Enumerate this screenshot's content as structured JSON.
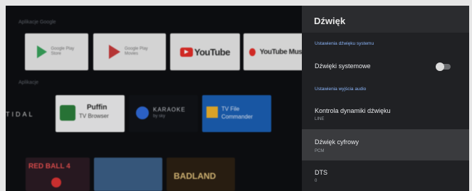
{
  "home": {
    "row1_label": "Aplikacje Google",
    "row2_label": "Aplikacje",
    "google_play_store": "Google Play Store",
    "google_play_movies": "Google Play Movies",
    "youtube": "YouTube",
    "youtube_music": "YouTube Music",
    "tidal": "TIDAL",
    "puffin_title": "Puffin",
    "puffin_sub": "TV Browser",
    "karaoke_title": "KARAOKE",
    "karaoke_sub": "by sky",
    "tvfile_title": "TV File",
    "tvfile_sub": "Commander",
    "game1": "RED BALL 4",
    "game3": "BADLAND"
  },
  "panel": {
    "title": "Dźwięk",
    "section_system": "Ustawienia dźwięku systemu",
    "system_sounds": "Dźwięki systemowe",
    "system_sounds_enabled": false,
    "section_output": "Ustawienia wyjścia audio",
    "drc_title": "Kontrola dynamiki dźwięku",
    "drc_value": "LINE",
    "digital_title": "Dźwięk cyfrowy",
    "digital_value": "PCM",
    "dts_title": "DTS",
    "dts_value": "0"
  }
}
